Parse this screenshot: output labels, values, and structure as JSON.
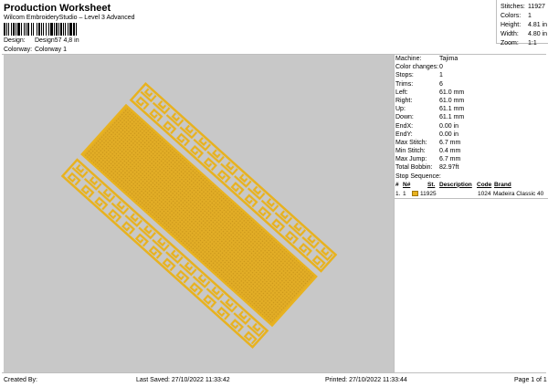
{
  "header": {
    "title": "Production Worksheet",
    "subtitle": "Wilcom EmbroideryStudio – Level 3 Advanced",
    "barcode_suffix": "!",
    "design_label": "Design:",
    "design_value": "Design57 4,8 in",
    "colorway_label": "Colorway:",
    "colorway_value": "Colorway 1"
  },
  "stats": [
    {
      "label": "Stitches:",
      "value": "11927"
    },
    {
      "label": "Colors:",
      "value": "1"
    },
    {
      "label": "Height:",
      "value": "4.81 in"
    },
    {
      "label": "Width:",
      "value": "4.80 in"
    },
    {
      "label": "Zoom:",
      "value": "1:1"
    }
  ],
  "info": [
    {
      "label": "Machine:",
      "value": "Tajima"
    },
    {
      "label": "Color changes:",
      "value": "0"
    },
    {
      "label": "Stops:",
      "value": "1"
    },
    {
      "label": "Trims:",
      "value": "6"
    },
    {
      "label": "Left:",
      "value": "61.0 mm"
    },
    {
      "label": "Right:",
      "value": "61.0 mm"
    },
    {
      "label": "Up:",
      "value": "61.1 mm"
    },
    {
      "label": "Down:",
      "value": "61.1 mm"
    },
    {
      "label": "EndX:",
      "value": "0.00 in"
    },
    {
      "label": "EndY:",
      "value": "0.00 in"
    },
    {
      "label": "Max Stitch:",
      "value": "6.7 mm"
    },
    {
      "label": "Min Stitch:",
      "value": "0.4 mm"
    },
    {
      "label": "Max Jump:",
      "value": "6.7 mm"
    },
    {
      "label": "Total Bobbin:",
      "value": "82.97ft"
    }
  ],
  "stop_sequence": {
    "title": "Stop Sequence:",
    "headers": {
      "num": "#",
      "n": "N#",
      "st": "St.",
      "description": "Description",
      "code": "Code",
      "brand": "Brand"
    },
    "rows": [
      {
        "num": "1.",
        "n": "1",
        "st": "11925",
        "description": "",
        "code": "1024",
        "brand": "Madeira Classic 40",
        "color": "#e8b21f"
      }
    ]
  },
  "footer": {
    "created_by": "Created By:",
    "last_saved": "Last Saved: 27/10/2022 11:33:42",
    "printed": "Printed: 27/10/2022 11:33:44",
    "page": "Page 1 of 1"
  },
  "colors": {
    "canvas_bg": "#c8c8c8",
    "thread": "#e8b21f",
    "thread_dark": "#b8860b"
  }
}
